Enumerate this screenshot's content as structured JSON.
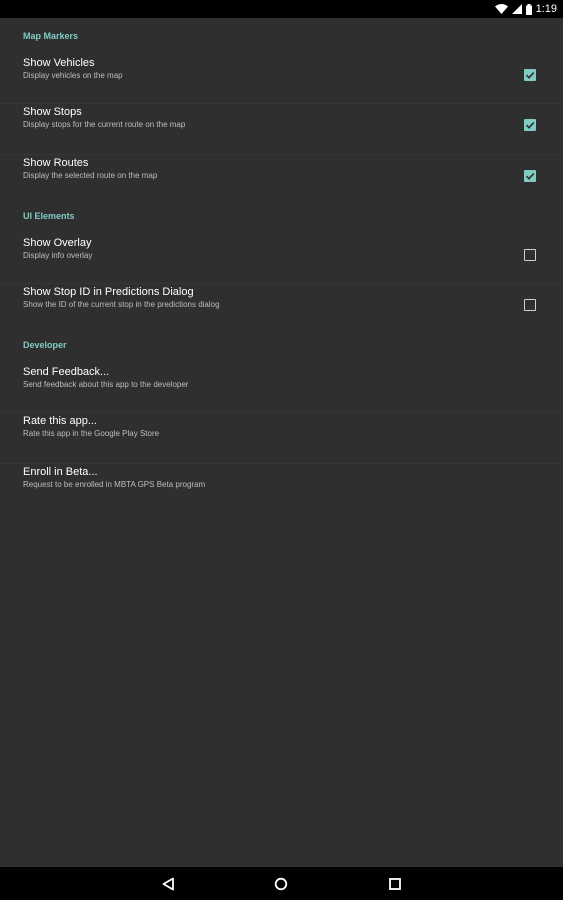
{
  "status_bar": {
    "time": "1:19",
    "icons": [
      "wifi-icon",
      "signal-icon",
      "battery-icon"
    ]
  },
  "colors": {
    "accent": "#80cbc4",
    "background": "#2f2f2f",
    "status_bar": "#000000"
  },
  "sections": {
    "map_markers": {
      "header": "Map Markers",
      "show_vehicles": {
        "title": "Show Vehicles",
        "summary": "Display vehicles on the map",
        "checked": true
      },
      "show_stops": {
        "title": "Show Stops",
        "summary": "Display stops for the current route on the map",
        "checked": true
      },
      "show_routes": {
        "title": "Show Routes",
        "summary": "Display the selected route on the map",
        "checked": true
      }
    },
    "ui_elements": {
      "header": "UI Elements",
      "show_overlay": {
        "title": "Show Overlay",
        "summary": "Display info overlay",
        "checked": false
      },
      "show_stop_id": {
        "title": "Show Stop ID in Predictions Dialog",
        "summary": "Show the ID of the current stop in the predictions dialog",
        "checked": false
      }
    },
    "developer": {
      "header": "Developer",
      "send_feedback": {
        "title": "Send Feedback...",
        "summary": "Send feedback about this app to the developer"
      },
      "rate_app": {
        "title": "Rate this app...",
        "summary": "Rate this app in the Google Play Store"
      },
      "enroll_beta": {
        "title": "Enroll in Beta...",
        "summary": "Request to be enrolled in MBTA GPS Beta program"
      }
    }
  },
  "nav_bar": {
    "buttons": [
      "back-icon",
      "home-icon",
      "recents-icon"
    ]
  }
}
